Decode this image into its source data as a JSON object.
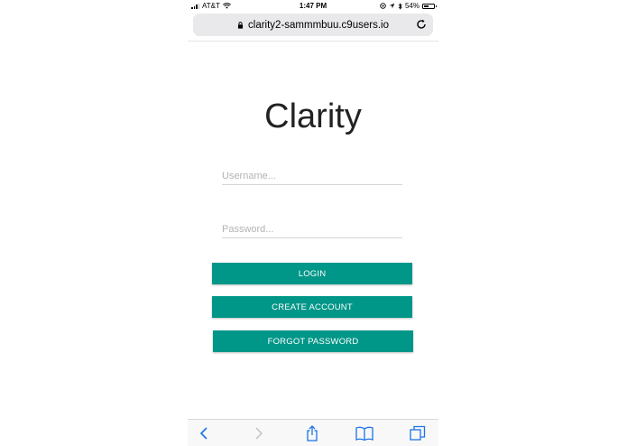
{
  "status_bar": {
    "carrier": "AT&T",
    "time": "1:47 PM",
    "battery": "54%",
    "battery_level": 0.54,
    "icons": [
      "signal-icon",
      "wifi-icon",
      "location-icon",
      "bluetooth-icon",
      "battery-icon"
    ]
  },
  "browser": {
    "url": "clarity2-sammmbuu.c9users.io",
    "toolbar_icons": [
      "back-icon",
      "forward-icon",
      "share-icon",
      "bookmarks-icon",
      "tabs-icon"
    ]
  },
  "page": {
    "title": "Clarity",
    "username_placeholder": "Username...",
    "password_placeholder": "Password...",
    "login_label": "LOGIN",
    "create_account_label": "CREATE ACCOUNT",
    "forgot_password_label": "FORGOT PASSWORD"
  },
  "colors": {
    "accent": "#009688",
    "ios_blue": "#1a73e8"
  }
}
